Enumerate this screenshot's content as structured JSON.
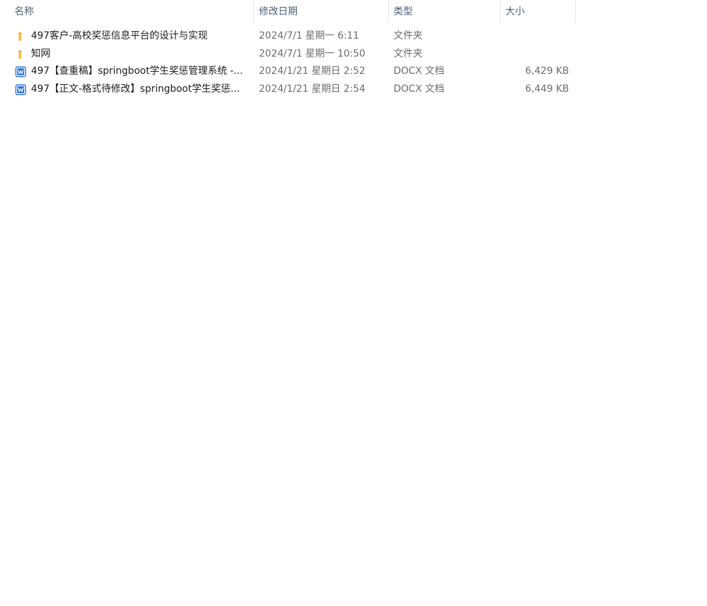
{
  "columns": {
    "name": "名称",
    "date": "修改日期",
    "type": "类型",
    "size": "大小"
  },
  "sort_indicator": "^",
  "files": [
    {
      "icon": "folder-icon",
      "name": "497客户-高校奖惩信息平台的设计与实现",
      "date": "2024/7/1 星期一 6:11",
      "type": "文件夹",
      "size": ""
    },
    {
      "icon": "folder-icon",
      "name": "知网",
      "date": "2024/7/1 星期一 10:50",
      "type": "文件夹",
      "size": ""
    },
    {
      "icon": "word-document-icon",
      "name": "497【查重稿】springboot学生奖惩管理系统 -...",
      "date": "2024/1/21 星期日 2:52",
      "type": "DOCX 文档",
      "size": "6,429 KB"
    },
    {
      "icon": "word-document-icon",
      "name": "497【正文-格式待修改】springboot学生奖惩...",
      "date": "2024/1/21 星期日 2:54",
      "type": "DOCX 文档",
      "size": "6,449 KB"
    }
  ],
  "colors": {
    "header_text": "#4c607a",
    "folder": "#f3c24a",
    "word_blue": "#2b6fd6"
  }
}
